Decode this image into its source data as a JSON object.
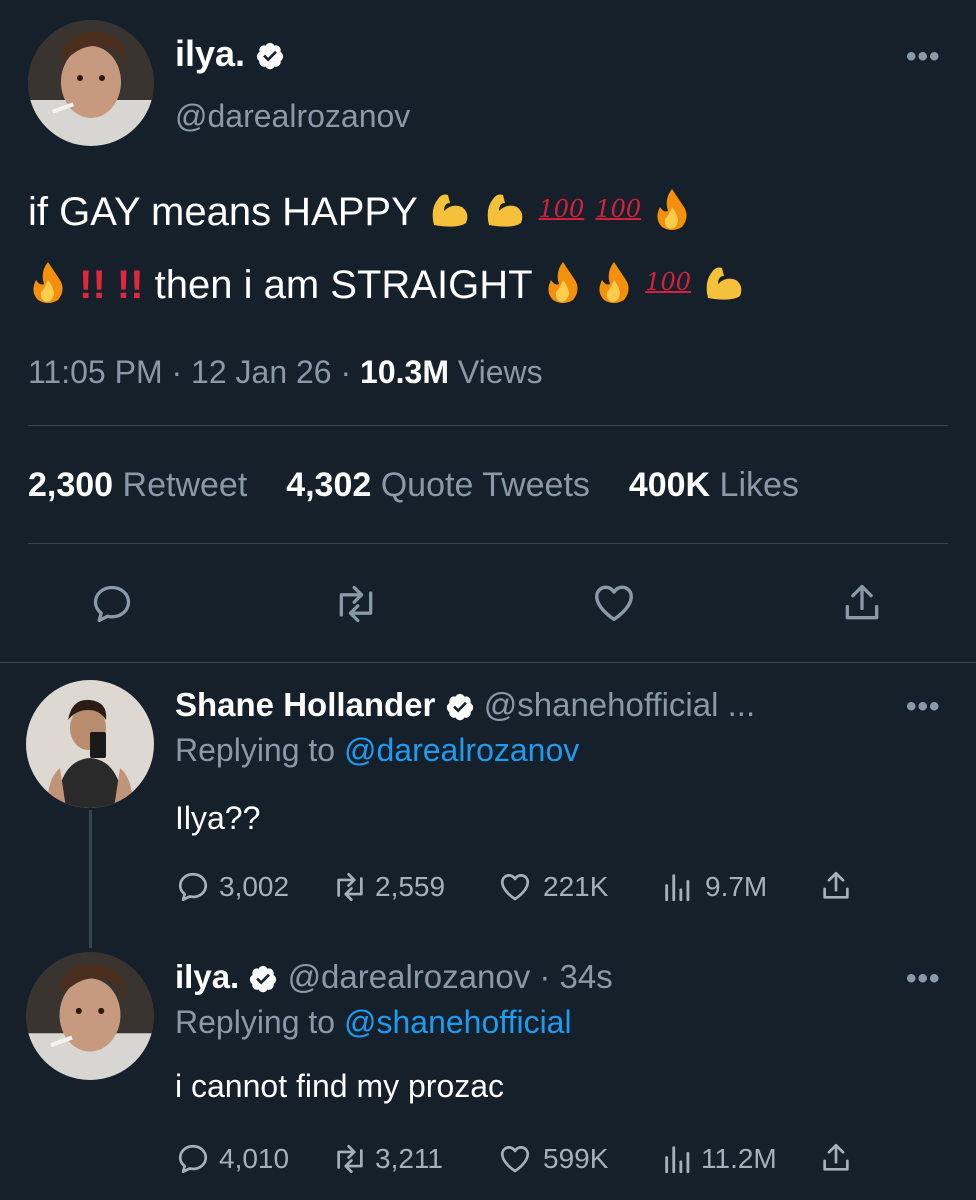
{
  "main_tweet": {
    "display_name": "ilya.",
    "handle": "@darealrozanov",
    "text_line1": "if GAY means HAPPY",
    "text_line2_mid": "then i am STRAIGHT",
    "hundred": "100",
    "bang": "!!",
    "time": "11:05 PM",
    "date": "12 Jan 26",
    "views_count": "10.3M",
    "views_label": "Views",
    "retweets_count": "2,300",
    "retweets_label": "Retweet",
    "quotes_count": "4,302",
    "quotes_label": "Quote Tweets",
    "likes_count": "400K",
    "likes_label": "Likes"
  },
  "reply1": {
    "display_name": "Shane Hollander",
    "handle": "@shanehofficial ...",
    "replying_prefix": "Replying to",
    "replying_to": "@darealrozanov",
    "text": "Ilya??",
    "replies": "3,002",
    "retweets": "2,559",
    "likes": "221K",
    "views": "9.7M"
  },
  "reply2": {
    "display_name": "ilya.",
    "handle_time": "@darealrozanov · 34s",
    "replying_prefix": "Replying to",
    "replying_to": "@shanehofficial",
    "text": "i cannot find my prozac",
    "replies": "4,010",
    "retweets": "3,211",
    "likes": "599K",
    "views": "11.2M"
  },
  "ui": {
    "more": "•••",
    "sep": "·"
  },
  "colors": {
    "background": "#15202b",
    "muted": "#8b98a5",
    "link": "#1d9bf0",
    "divider": "#38444d"
  }
}
